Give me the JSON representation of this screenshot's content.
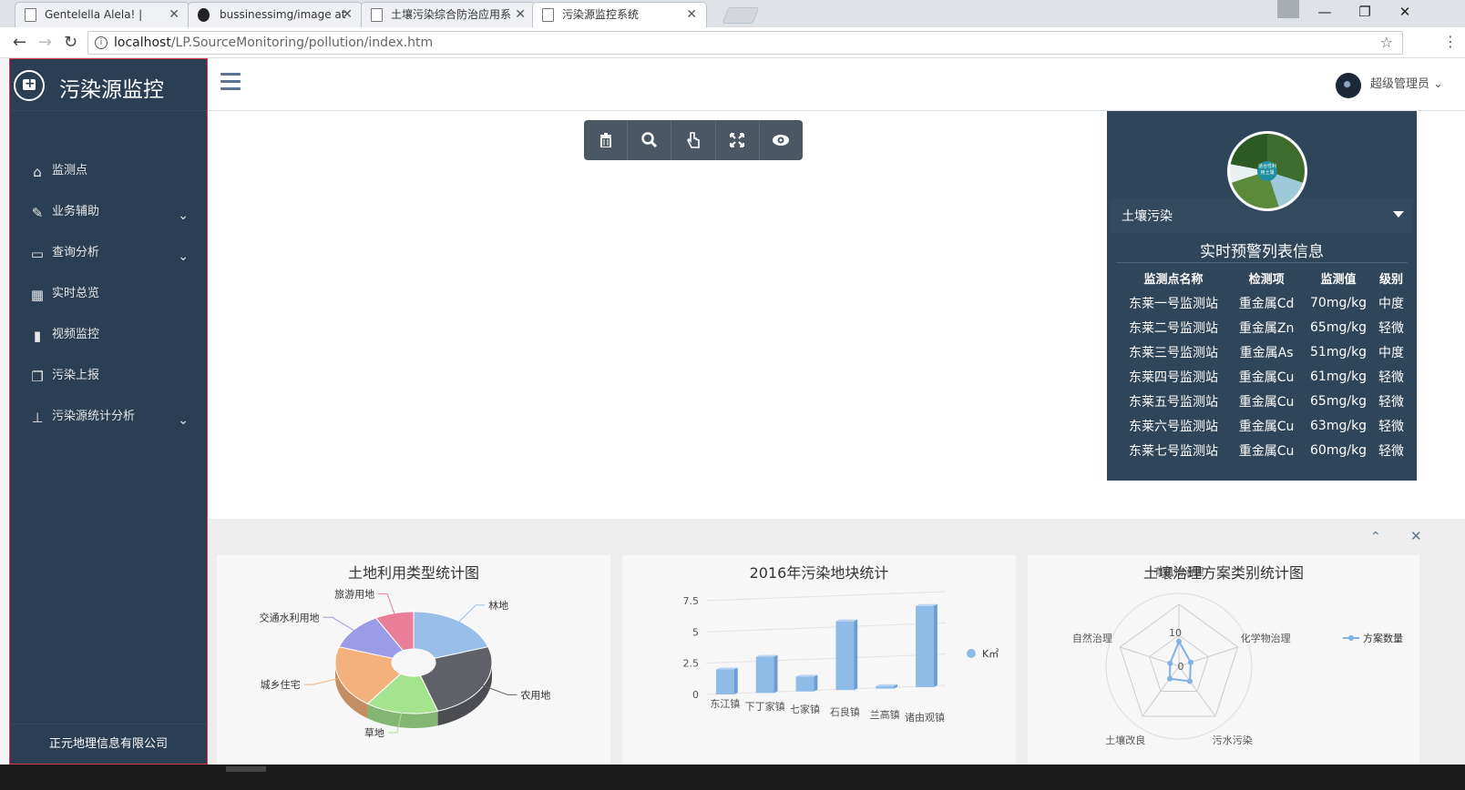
{
  "browser": {
    "tabs": [
      {
        "title": "Gentelella Alela! |",
        "active": false
      },
      {
        "title": "bussinessimg/image at",
        "active": false
      },
      {
        "title": "土壤污染综合防治应用系",
        "active": false
      },
      {
        "title": "污染源监控系统",
        "active": true
      }
    ],
    "url_host": "localhost",
    "url_path": "/LP.SourceMonitoring/pollution/index.htm"
  },
  "sidebar": {
    "brand": "污染源监控",
    "items": [
      {
        "label": "监测点",
        "icon": "home-icon",
        "expandable": false
      },
      {
        "label": "业务辅助",
        "icon": "edit-icon",
        "expandable": true
      },
      {
        "label": "查询分析",
        "icon": "desktop-icon",
        "expandable": true
      },
      {
        "label": "实时总览",
        "icon": "table-icon",
        "expandable": false
      },
      {
        "label": "视频监控",
        "icon": "bar-chart-icon",
        "expandable": false
      },
      {
        "label": "污染上报",
        "icon": "copy-icon",
        "expandable": false
      },
      {
        "label": "污染源统计分析",
        "icon": "sitemap-icon",
        "expandable": true
      }
    ],
    "footer": "正元地理信息有限公司"
  },
  "header": {
    "user": "超级管理员"
  },
  "toolbar": [
    "trash-icon",
    "search-icon",
    "hand-pointer-icon",
    "expand-icon",
    "eye-icon"
  ],
  "panel": {
    "logo_text": "适合性利用土壤",
    "category": "土壤污染",
    "title": "实时预警列表信息",
    "columns": [
      "监测点名称",
      "检测项",
      "监测值",
      "级别"
    ],
    "rows": [
      [
        "东莱一号监测站",
        "重金属Cd",
        "70mg/kg",
        "中度"
      ],
      [
        "东莱二号监测站",
        "重金属Zn",
        "65mg/kg",
        "轻微"
      ],
      [
        "东莱三号监测站",
        "重金属As",
        "51mg/kg",
        "中度"
      ],
      [
        "东莱四号监测站",
        "重金属Cu",
        "61mg/kg",
        "轻微"
      ],
      [
        "东莱五号监测站",
        "重金属Cu",
        "65mg/kg",
        "轻微"
      ],
      [
        "东莱六号监测站",
        "重金属Cu",
        "63mg/kg",
        "轻微"
      ],
      [
        "东莱七号监测站",
        "重金属Cu",
        "60mg/kg",
        "轻微"
      ]
    ]
  },
  "colors": {
    "sidebar": "#2a3f54",
    "panel": "#2f4559",
    "bar": "#8fbbe8"
  },
  "chart_data": [
    {
      "type": "pie",
      "title": "土地利用类型统计图",
      "categories": [
        "林地",
        "农用地",
        "草地",
        "城乡住宅",
        "交通水利用地",
        "旅游用地"
      ],
      "values": [
        20,
        25,
        15,
        20,
        12,
        8
      ],
      "colors": [
        "#99bfe8",
        "#5f6068",
        "#a4e48f",
        "#f3b27b",
        "#9c9ce6",
        "#ea7d97"
      ]
    },
    {
      "type": "bar",
      "title": "2016年污染地块统计",
      "categories": [
        "东江镇",
        "下丁家镇",
        "七家镇",
        "石良镇",
        "兰高镇",
        "诸由观镇"
      ],
      "series": [
        {
          "name": "K㎡",
          "values": [
            2,
            2.9,
            1.2,
            5.5,
            0.2,
            6.5
          ]
        }
      ],
      "yticks": [
        "0",
        "2.5",
        "5",
        "7.5"
      ],
      "ylim": [
        0,
        7.5
      ]
    },
    {
      "type": "radar",
      "title": "土壤治理方案类别统计图",
      "categories": [
        "有机物治理",
        "化学物治理",
        "污水污染",
        "土壤改良",
        "自然治理"
      ],
      "series": [
        {
          "name": "方案数量",
          "values": [
            8,
            4,
            6,
            5,
            3
          ]
        }
      ],
      "ticks": [
        "0",
        "10"
      ],
      "max": 20
    }
  ]
}
